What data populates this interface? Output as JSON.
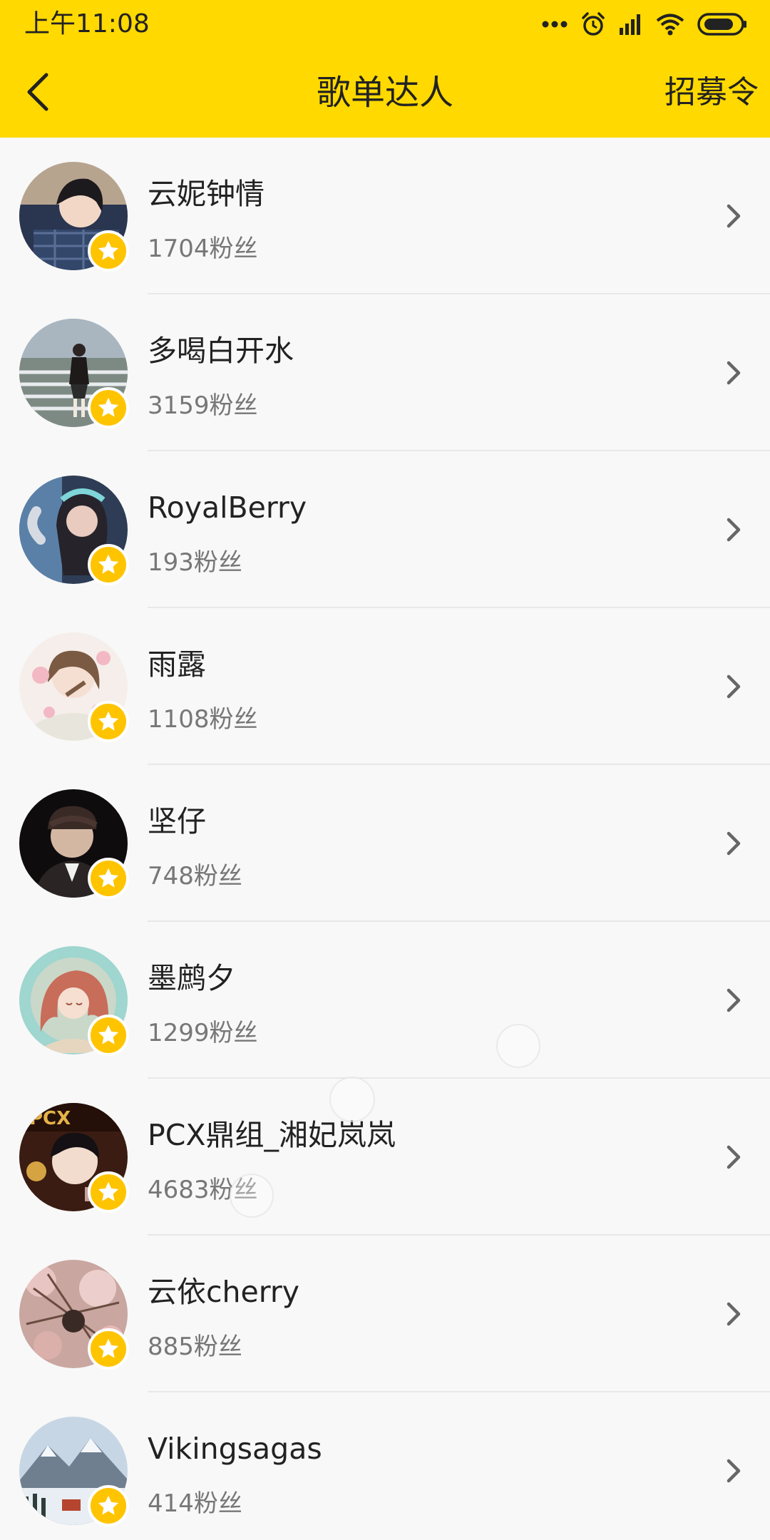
{
  "status_bar": {
    "time": "上午11:08",
    "icons": [
      "more-dots-icon",
      "alarm-icon",
      "signal-icon",
      "wifi-icon",
      "battery-icon"
    ]
  },
  "nav": {
    "title": "歌单达人",
    "right_action": "招募令",
    "back_icon": "back-chevron-icon"
  },
  "colors": {
    "accent": "#ffd900",
    "badge": "#ffc400",
    "background": "#f8f8f8"
  },
  "list": [
    {
      "name": "云妮钟情",
      "fans": "1704粉丝",
      "avatar_icon": "user-avatar-icon",
      "badge_icon": "star-icon"
    },
    {
      "name": "多喝白开水",
      "fans": "3159粉丝",
      "avatar_icon": "user-avatar-icon",
      "badge_icon": "star-icon"
    },
    {
      "name": "RoyalBerry",
      "fans": "193粉丝",
      "avatar_icon": "user-avatar-icon",
      "badge_icon": "star-icon"
    },
    {
      "name": "雨露",
      "fans": "1108粉丝",
      "avatar_icon": "user-avatar-icon",
      "badge_icon": "star-icon"
    },
    {
      "name": "坚仔",
      "fans": "748粉丝",
      "avatar_icon": "user-avatar-icon",
      "badge_icon": "star-icon"
    },
    {
      "name": "墨鹧夕",
      "fans": "1299粉丝",
      "avatar_icon": "user-avatar-icon",
      "badge_icon": "star-icon"
    },
    {
      "name": "PCX鼎组_湘妃岚岚",
      "fans": "4683粉丝",
      "avatar_icon": "user-avatar-icon",
      "badge_icon": "star-icon"
    },
    {
      "name": "云依cherry",
      "fans": "885粉丝",
      "avatar_icon": "user-avatar-icon",
      "badge_icon": "star-icon"
    },
    {
      "name": "Vikingsagas",
      "fans": "414粉丝",
      "avatar_icon": "user-avatar-icon",
      "badge_icon": "star-icon"
    }
  ]
}
